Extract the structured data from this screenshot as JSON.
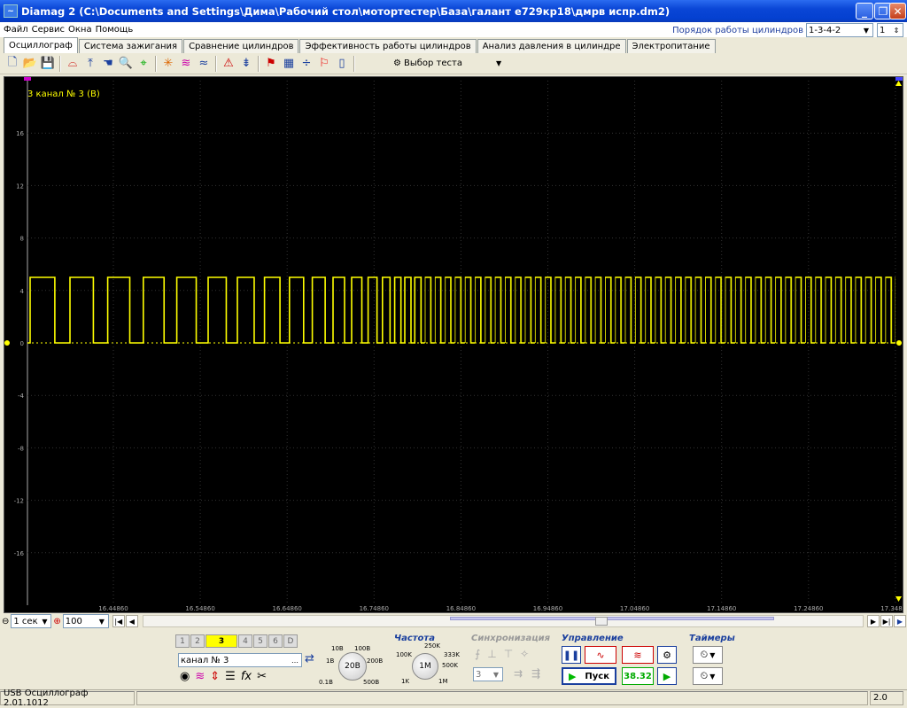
{
  "window": {
    "title": "Diamag 2 (C:\\Documents and Settings\\Дима\\Рабочий стол\\мотортестер\\База\\галант е729кр18\\дмрв испр.dm2)",
    "icon": "diamag-app-icon"
  },
  "menu": [
    "Файл",
    "Сервис",
    "Окна",
    "Помощь"
  ],
  "cylinder_order": {
    "label": "Порядок работы цилиндров",
    "value": "1-3-4-2",
    "spinner_value": "1"
  },
  "tabs": [
    "Осциллограф",
    "Система зажигания",
    "Сравнение цилиндров",
    "Эффективность работы цилиндров",
    "Анализ давления в цилиндре",
    "Электропитание"
  ],
  "active_tab": 0,
  "toolbar": {
    "icons": [
      "new-file-icon",
      "open-folder-icon",
      "save-disk-icon",
      "channel-icon",
      "cursor-icon",
      "hand-pan-icon",
      "zoom-icon",
      "measure-icon",
      "spark-icon",
      "filter-icon",
      "multi-wave-icon",
      "auto-scale-icon",
      "zero-icon",
      "marker-icon",
      "grid-icon",
      "split-icon",
      "flag-icon",
      "page-icon"
    ],
    "test_select_label": "Выбор теста"
  },
  "scope": {
    "channel_label": "3  канал № 3 (В)",
    "trace_color": "#ffff00",
    "y_ticks": [
      "16",
      "12",
      "8",
      "4",
      "0",
      "-4",
      "-8",
      "-12",
      "-16"
    ],
    "x_ticks": [
      "16.44860",
      "16.54860",
      "16.64860",
      "16.74860",
      "16.84860",
      "16.94860",
      "17.04860",
      "17.14860",
      "17.24860",
      "17.34860"
    ],
    "y_range": [
      -20,
      20
    ],
    "signal_high": 5,
    "signal_low": 0,
    "start_marker": "1",
    "end_marker": "2"
  },
  "scroll": {
    "timebase": "1 сек",
    "zoom": "100"
  },
  "channels": {
    "buttons": [
      "1",
      "2",
      "3",
      "4",
      "5",
      "6",
      "D"
    ],
    "active": "3",
    "name_value": "канал № 3",
    "voltage_knob": {
      "value": "20В",
      "labels": [
        "10В",
        "100В",
        "1В",
        "200В",
        "0.1В",
        "500В"
      ]
    }
  },
  "frequency": {
    "title": "Частота",
    "knob_value": "1M",
    "labels": [
      "250K",
      "100K",
      "333K",
      "500K",
      "1K",
      "1M"
    ]
  },
  "sync": {
    "title": "Синхронизация",
    "value": "3"
  },
  "control": {
    "title": "Управление",
    "start_label": "Пуск",
    "counter": "38.32"
  },
  "timers": {
    "title": "Таймеры"
  },
  "status": {
    "left": "USB Осциллограф  2.01.1012",
    "right": "2.0"
  }
}
